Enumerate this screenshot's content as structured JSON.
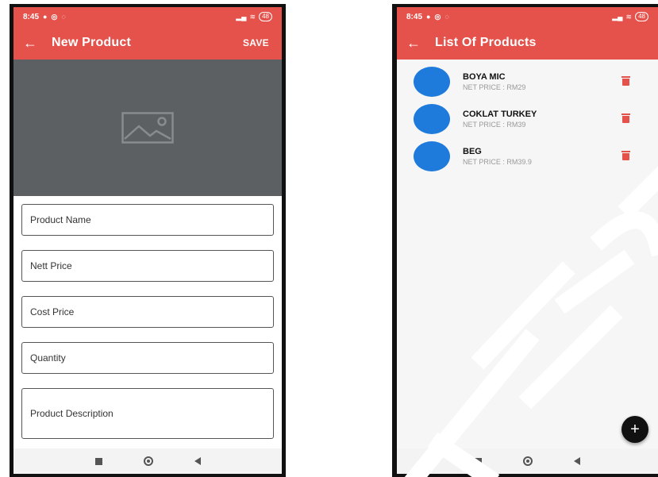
{
  "left_screen": {
    "status": {
      "time": "8:45",
      "battery": "48"
    },
    "appbar": {
      "back": "←",
      "title": "New Product",
      "save_label": "SAVE"
    },
    "image_placeholder": "image-icon",
    "form": {
      "product_name": "Product Name",
      "nett_price": "Nett Price",
      "cost_price": "Cost Price",
      "quantity": "Quantity",
      "product_description": "Product Description"
    }
  },
  "right_screen": {
    "status": {
      "time": "8:45",
      "battery": "48"
    },
    "appbar": {
      "back": "←",
      "title": "List Of Products"
    },
    "products": [
      {
        "name": "BOYA MIC",
        "price": "NET PRICE : RM29"
      },
      {
        "name": "COKLAT TURKEY",
        "price": "NET PRICE : RM39"
      },
      {
        "name": "BEG",
        "price": "NET PRICE : RM39.9"
      }
    ],
    "fab_label": "+"
  },
  "colors": {
    "accent": "#e5524c",
    "avatar": "#1f7bdb",
    "image_bg": "#5c6063"
  },
  "icons": [
    "back-arrow-icon",
    "image-icon",
    "delete-icon",
    "add-icon",
    "nav-recent-icon",
    "nav-home-icon",
    "nav-back-icon"
  ]
}
